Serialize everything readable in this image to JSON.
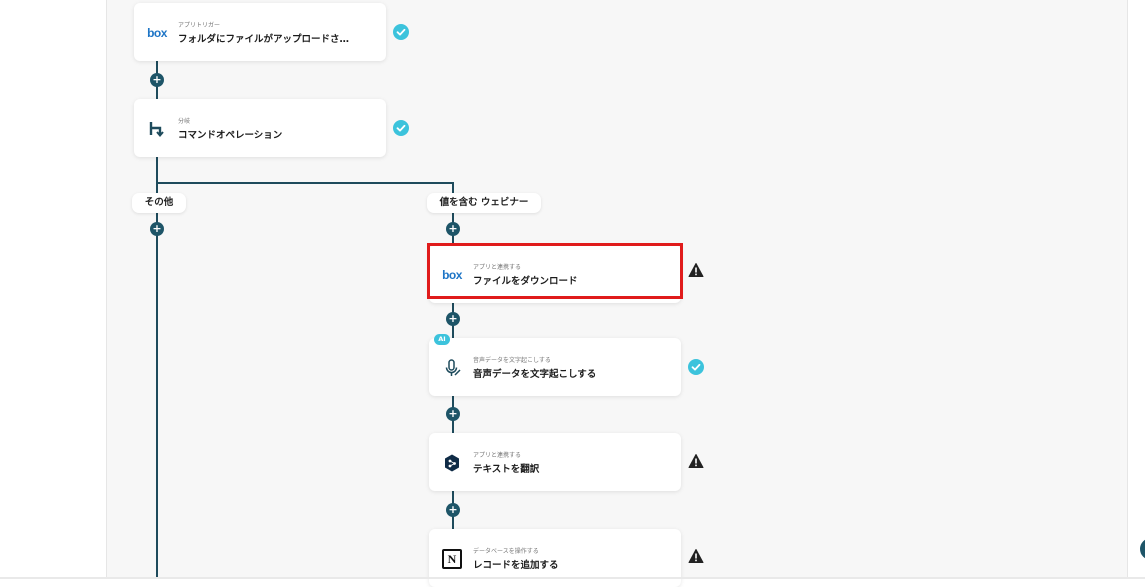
{
  "colors": {
    "connector": "#1e4b5c",
    "success": "#3cc3dc",
    "highlight": "#e01b1b",
    "box_brand": "#1e75c6"
  },
  "flow": {
    "nodes": [
      {
        "id": "trigger",
        "small_label": "アプリトリガー",
        "title": "フォルダにファイルがアップロードさ…",
        "icon": "box-logo-icon",
        "icon_text": "box",
        "status": "success"
      },
      {
        "id": "branch",
        "small_label": "分岐",
        "title": "コマンドオペレーション",
        "icon": "branch-icon",
        "status": "success"
      },
      {
        "id": "download",
        "small_label": "アプリと連携する",
        "title": "ファイルをダウンロード",
        "icon": "box-logo-icon",
        "icon_text": "box",
        "status": "warning",
        "highlighted": true
      },
      {
        "id": "transcribe",
        "small_label": "音声データを文字起こしする",
        "title": "音声データを文字起こしする",
        "icon": "microphone-icon",
        "badge": "AI",
        "status": "success"
      },
      {
        "id": "translate",
        "small_label": "アプリと連携する",
        "title": "テキストを翻訳",
        "icon": "deepl-icon",
        "status": "warning"
      },
      {
        "id": "notion",
        "small_label": "データベースを操作する",
        "title": "レコードを追加する",
        "icon": "notion-icon",
        "icon_text": "N",
        "status": "warning"
      }
    ],
    "branches": {
      "other_label": "その他",
      "contains_label": "値を含む ウェビナー"
    },
    "add_step_symbol": "+"
  }
}
